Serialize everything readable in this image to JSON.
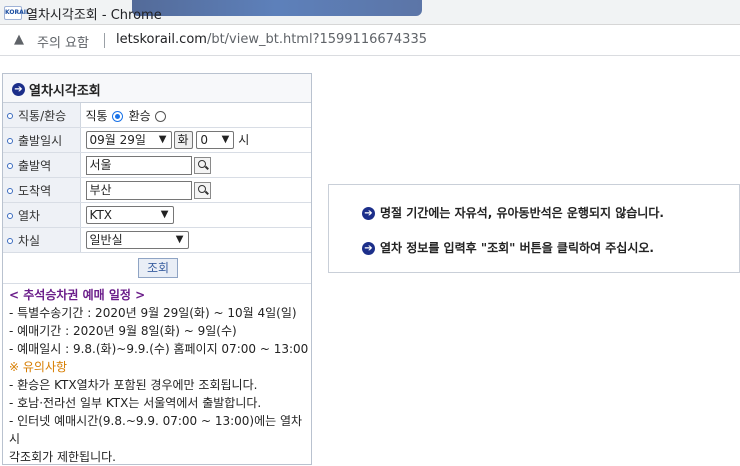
{
  "window": {
    "title": "열차시각조회 - Chrome",
    "favicon_text": "KORAIL",
    "security_label": "주의 요함",
    "url_host": "letskorail.com",
    "url_path": "/bt/view_bt.html?1599116674335"
  },
  "panel": {
    "title": "열차시각조회",
    "rows": {
      "route_type": {
        "label": "직통/환승",
        "option_direct": "직통",
        "option_transfer": "환승",
        "selected": "직통"
      },
      "departure_datetime": {
        "label": "출발일시",
        "date_value": "09월 29일",
        "weekday_button": "화",
        "hour_value": "0",
        "hour_unit": "시"
      },
      "departure_station": {
        "label": "출발역",
        "value": "서울"
      },
      "arrival_station": {
        "label": "도착역",
        "value": "부산"
      },
      "train": {
        "label": "열차",
        "value": "KTX"
      },
      "car_class": {
        "label": "차실",
        "value": "일반실"
      }
    },
    "query_button": "조회",
    "notice": {
      "heading": "< 추석승차권 예매 일정 >",
      "lines": [
        "- 특별수송기간 : 2020년 9월 29일(화) ~ 10월 4일(일)",
        "- 예매기간 : 2020년 9월 8일(화) ~ 9일(수)",
        "- 예매일시 : 9.8.(화)~9.9.(수) 홈페이지 07:00 ~ 13:00"
      ],
      "caution_heading": "※ 유의사항",
      "caution_lines": [
        "- 환승은 KTX열차가 포함된 경우에만 조회됩니다.",
        "- 호남·전라선 일부 KTX는 서울역에서 출발합니다.",
        "- 인터넷 예매시간(9.8.~9.9. 07:00 ~ 13:00)에는 열차시",
        "각조회가 제한됩니다."
      ]
    }
  },
  "messages": {
    "line1": "명절 기간에는 자유석, 유아동반석은 운행되지 않습니다.",
    "line2": "열차 정보를 입력후 \"조회\" 버튼을 클릭하여 주십시오."
  }
}
